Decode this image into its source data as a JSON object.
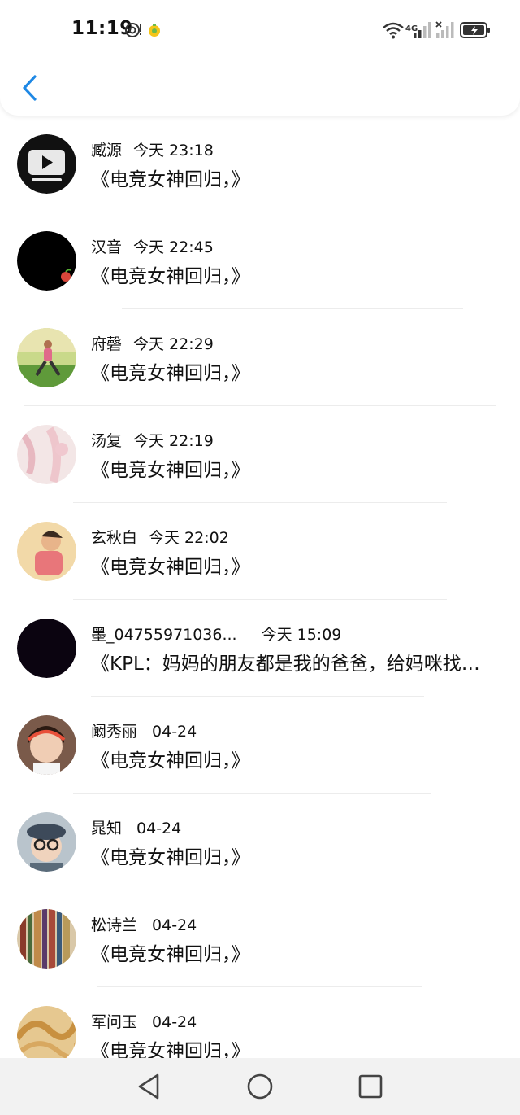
{
  "status_bar": {
    "time": "11:19",
    "network_label": "4G",
    "icons": [
      "notification-icon",
      "app-badge-icon",
      "wifi-icon",
      "signal-icon",
      "signal-no-service-icon",
      "battery-icon"
    ]
  },
  "header": {
    "back_icon": "chevron-left-icon"
  },
  "comments": [
    {
      "name": "臧源",
      "time": "今天 23:18",
      "text": "《电竞女神回归，》"
    },
    {
      "name": "汉音",
      "time": "今天 22:45",
      "text": "《电竞女神回归，》"
    },
    {
      "name": "府磬",
      "time": "今天 22:29",
      "text": "《电竞女神回归，》"
    },
    {
      "name": "汤复",
      "time": "今天 22:19",
      "text": "《电竞女神回归，》"
    },
    {
      "name": "玄秋白",
      "time": "今天 22:02",
      "text": "《电竞女神回归，》"
    },
    {
      "name": "墨_04755971036...",
      "time": "今天 15:09",
      "text": "《KPL：妈妈的朋友都是我的爸爸，给妈咪找…"
    },
    {
      "name": "阚秀丽",
      "time": "04-24",
      "text": "《电竞女神回归，》"
    },
    {
      "name": "晁知",
      "time": "04-24",
      "text": "《电竞女神回归，》"
    },
    {
      "name": "松诗兰",
      "time": "04-24",
      "text": "《电竞女神回归，》"
    },
    {
      "name": "军问玉",
      "time": "04-24",
      "text": "《电竞女神回归，》"
    }
  ],
  "nav_bar": {
    "buttons": [
      "back-triangle-icon",
      "home-circle-icon",
      "recents-square-icon"
    ]
  },
  "colors": {
    "accent": "#1e88e5",
    "text": "#111111",
    "divider": "#ececec",
    "nav_bg": "#f2f2f2"
  }
}
